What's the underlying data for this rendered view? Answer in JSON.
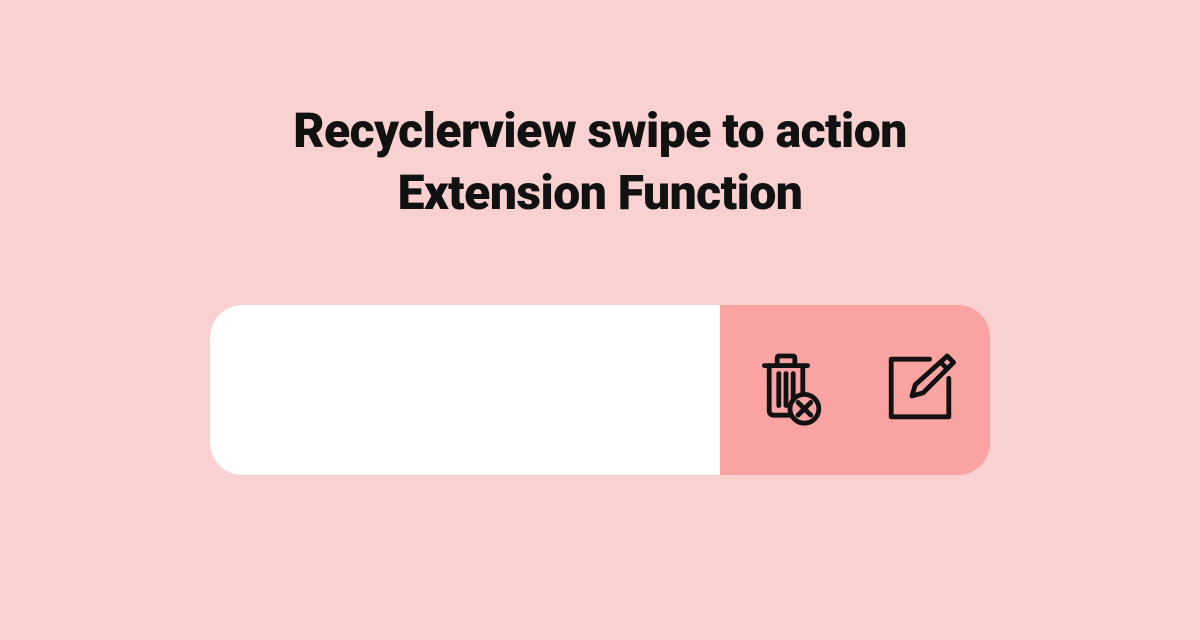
{
  "title_line1": "Recyclerview swipe to action",
  "title_line2": "Extension Function",
  "actions": {
    "delete": {
      "name": "delete"
    },
    "edit": {
      "name": "edit"
    }
  },
  "colors": {
    "background": "#f9d1d1",
    "action_bg": "#f9a3a3",
    "card_bg": "#ffffff",
    "icon": "#111111"
  }
}
